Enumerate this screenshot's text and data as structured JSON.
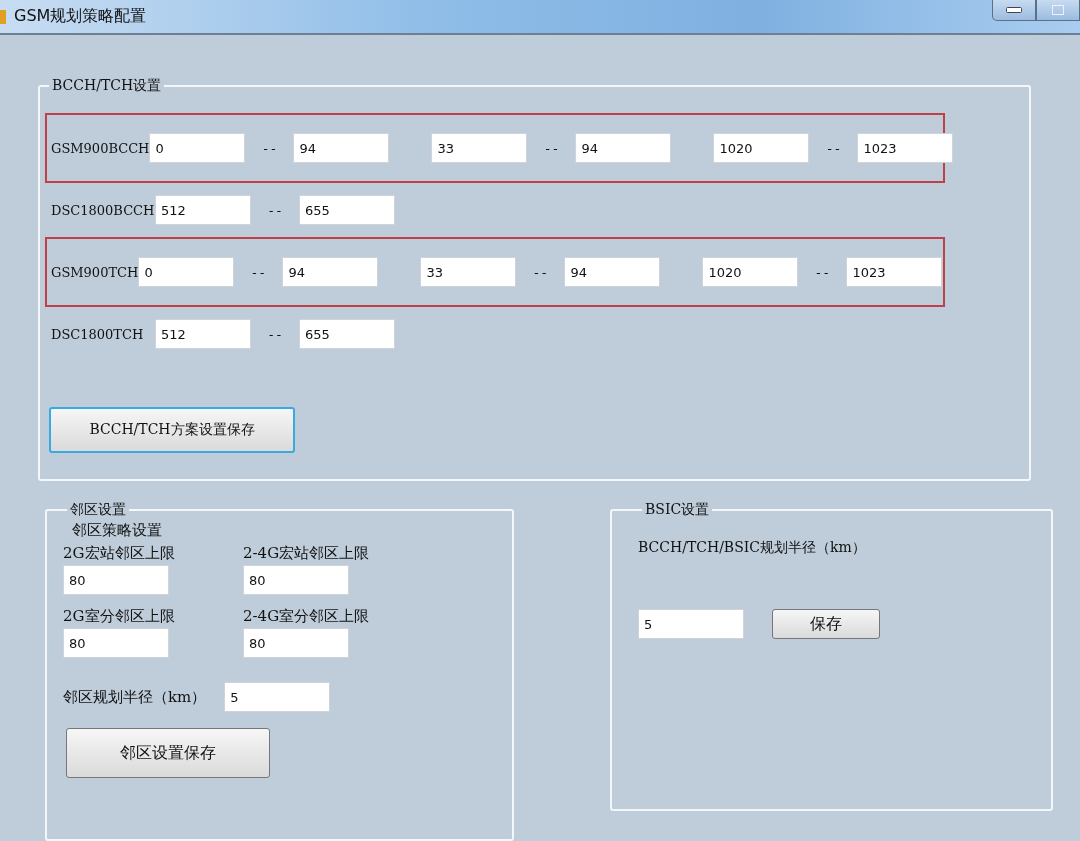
{
  "window": {
    "title": "GSM规划策略配置"
  },
  "bcch_tch": {
    "title": "BCCH/TCH设置",
    "rows": [
      {
        "label": "GSM900BCCH",
        "highlighted": true,
        "ranges": [
          {
            "from": "0",
            "sep": "--",
            "to": "94"
          },
          {
            "from": "33",
            "sep": "--",
            "to": "94"
          },
          {
            "from": "1020",
            "sep": "--",
            "to": "1023"
          }
        ]
      },
      {
        "label": "DSC1800BCCH",
        "highlighted": false,
        "ranges": [
          {
            "from": "512",
            "sep": "--",
            "to": "655"
          }
        ]
      },
      {
        "label": "GSM900TCH",
        "highlighted": true,
        "ranges": [
          {
            "from": "0",
            "sep": "--",
            "to": "94"
          },
          {
            "from": "33",
            "sep": "--",
            "to": "94"
          },
          {
            "from": "1020",
            "sep": "--",
            "to": "1023"
          }
        ]
      },
      {
        "label": "DSC1800TCH",
        "highlighted": false,
        "ranges": [
          {
            "from": "512",
            "sep": "--",
            "to": "655"
          }
        ]
      }
    ],
    "save_button": {
      "label": "BCCH/TCH方案设置保存",
      "focused": true
    }
  },
  "neighbor": {
    "title": "邻区设置",
    "subtitle": "邻区策略设置",
    "fields": [
      {
        "label": "2G宏站邻区上限",
        "value": "80"
      },
      {
        "label": "2-4G宏站邻区上限",
        "value": "80"
      },
      {
        "label": "2G室分邻区上限",
        "value": "80"
      },
      {
        "label": "2-4G室分邻区上限",
        "value": "80"
      }
    ],
    "radius": {
      "label": "邻区规划半径（km）",
      "value": "5"
    },
    "save_button": {
      "label": "邻区设置保存",
      "focused": false
    }
  },
  "bsic": {
    "title": "BSIC设置",
    "label": "BCCH/TCH/BSIC规划半径（km）",
    "value": "5",
    "save_button": {
      "label": "保存",
      "focused": false
    }
  }
}
